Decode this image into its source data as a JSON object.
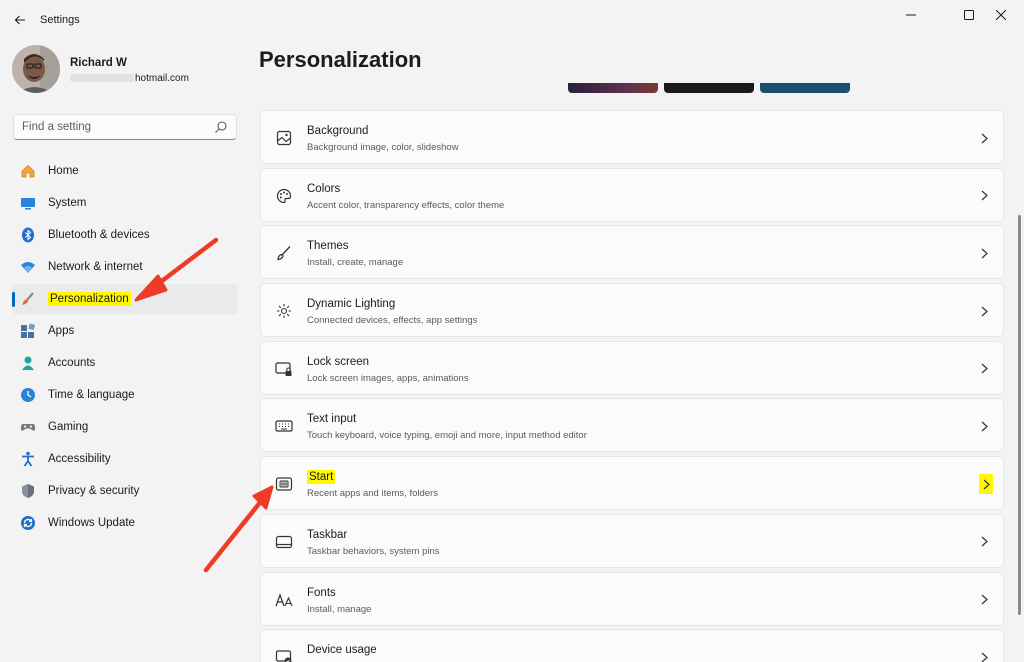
{
  "window": {
    "title": "Settings",
    "back_icon": "back-arrow-icon",
    "minimize_icon": "minimize-icon",
    "maximize_icon": "maximize-icon",
    "close_icon": "close-icon"
  },
  "profile": {
    "name": "Richard W",
    "email_suffix": "hotmail.com"
  },
  "search": {
    "placeholder": "Find a setting",
    "icon": "search-icon"
  },
  "nav": {
    "items": [
      {
        "label": "Home",
        "icon": "home-icon",
        "active": false
      },
      {
        "label": "System",
        "icon": "system-icon",
        "active": false
      },
      {
        "label": "Bluetooth & devices",
        "icon": "bluetooth-icon",
        "active": false
      },
      {
        "label": "Network & internet",
        "icon": "network-icon",
        "active": false
      },
      {
        "label": "Personalization",
        "icon": "personalization-icon",
        "active": true
      },
      {
        "label": "Apps",
        "icon": "apps-icon",
        "active": false
      },
      {
        "label": "Accounts",
        "icon": "accounts-icon",
        "active": false
      },
      {
        "label": "Time & language",
        "icon": "time-language-icon",
        "active": false
      },
      {
        "label": "Gaming",
        "icon": "gaming-icon",
        "active": false
      },
      {
        "label": "Accessibility",
        "icon": "accessibility-icon",
        "active": false
      },
      {
        "label": "Privacy & security",
        "icon": "privacy-icon",
        "active": false
      },
      {
        "label": "Windows Update",
        "icon": "windows-update-icon",
        "active": false
      }
    ]
  },
  "main": {
    "title": "Personalization",
    "cards": [
      {
        "title": "Background",
        "subtitle": "Background image, color, slideshow",
        "icon": "background-icon"
      },
      {
        "title": "Colors",
        "subtitle": "Accent color, transparency effects, color theme",
        "icon": "colors-icon"
      },
      {
        "title": "Themes",
        "subtitle": "Install, create, manage",
        "icon": "themes-icon"
      },
      {
        "title": "Dynamic Lighting",
        "subtitle": "Connected devices, effects, app settings",
        "icon": "dynamic-lighting-icon"
      },
      {
        "title": "Lock screen",
        "subtitle": "Lock screen images, apps, animations",
        "icon": "lock-screen-icon"
      },
      {
        "title": "Text input",
        "subtitle": "Touch keyboard, voice typing, emoji and more, input method editor",
        "icon": "keyboard-icon"
      },
      {
        "title": "Start",
        "subtitle": "Recent apps and items, folders",
        "icon": "start-icon"
      },
      {
        "title": "Taskbar",
        "subtitle": "Taskbar behaviors, system pins",
        "icon": "taskbar-icon"
      },
      {
        "title": "Fonts",
        "subtitle": "Install, manage",
        "icon": "fonts-icon"
      },
      {
        "title": "Device usage",
        "subtitle": "",
        "icon": "device-usage-icon"
      }
    ]
  },
  "colors": {
    "accent": "#0067c0",
    "highlight": "#fff700",
    "annotation_arrow": "#ee3b26"
  }
}
